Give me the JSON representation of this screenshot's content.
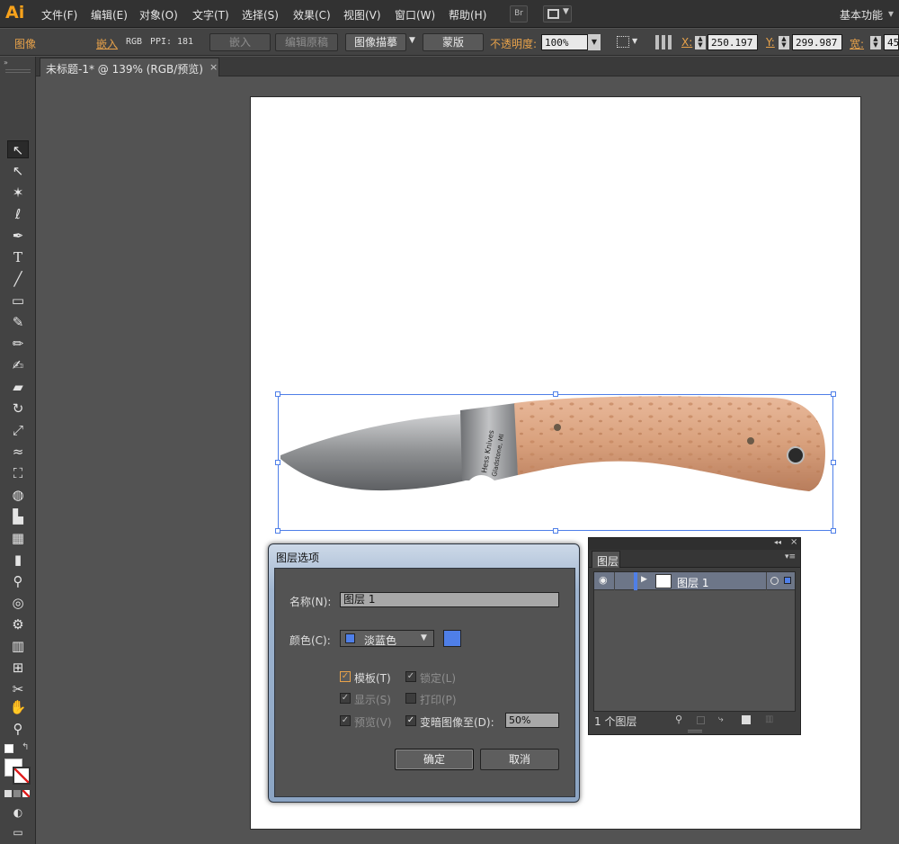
{
  "app": {
    "logo": "Ai",
    "workspace": "基本功能"
  },
  "menu": [
    "文件(F)",
    "编辑(E)",
    "对象(O)",
    "文字(T)",
    "选择(S)",
    "效果(C)",
    "视图(V)",
    "窗口(W)",
    "帮助(H)"
  ],
  "menu_extra": {
    "br": "Br"
  },
  "control": {
    "kind": "图像",
    "embed_status": "嵌入",
    "color_mode": "RGB",
    "ppi_label": "PPI:",
    "ppi_value": "181",
    "embed_btn": "嵌入",
    "edit_original_btn": "编辑原稿",
    "image_trace_btn": "图像描摹",
    "mask_btn": "蒙版",
    "opacity_label": "不透明度:",
    "opacity_value": "100%",
    "x_label": "X:",
    "x_value": "250.197",
    "y_label": "Y:",
    "y_value": "299.987",
    "w_label": "宽:",
    "w_value": "45"
  },
  "document_tab": {
    "title": "未标题-1* @ 139% (RGB/预览)",
    "close": "×"
  },
  "dialog": {
    "title": "图层选项",
    "name_label": "名称(N):",
    "name_value": "图层 1",
    "color_label": "颜色(C):",
    "color_value": "淡蓝色",
    "color_hex": "#4f7fe8",
    "template_label": "模板(T)",
    "lock_label": "锁定(L)",
    "show_label": "显示(S)",
    "print_label": "打印(P)",
    "preview_label": "预览(V)",
    "dim_label": "变暗图像至(D):",
    "dim_value": "50%",
    "ok": "确定",
    "cancel": "取消"
  },
  "layers_panel": {
    "tab": "图层",
    "layer_name": "图层 1",
    "footer": "1 个图层"
  },
  "knife_text": {
    "line1": "Hess Knives",
    "line2": "Gladstone, MI"
  },
  "colors": {
    "accent_orange": "#e8a24a",
    "selection_blue": "#4f7fe8"
  }
}
